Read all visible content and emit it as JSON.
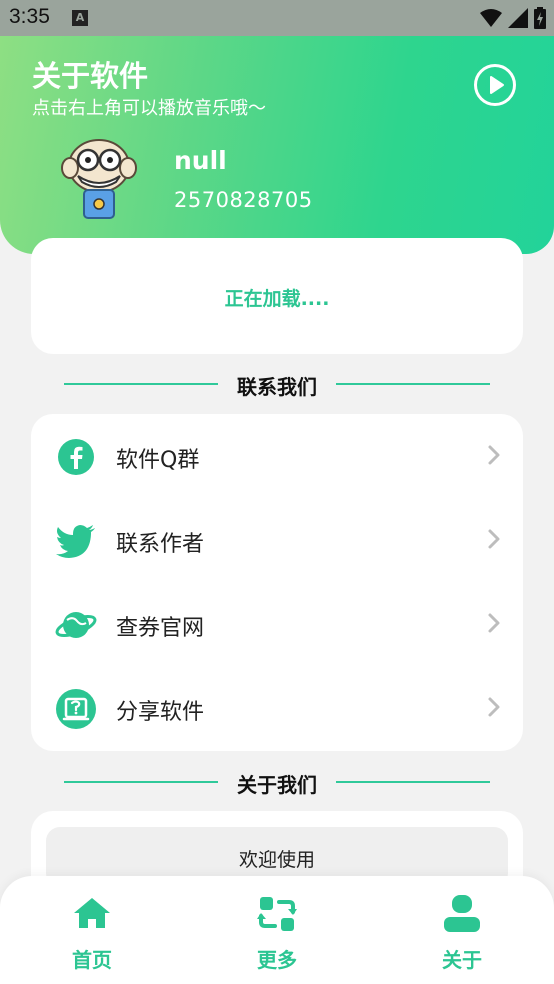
{
  "status_bar": {
    "time": "3:35",
    "notification_letter": "A",
    "icons": [
      "wifi-icon",
      "signal-icon",
      "battery-icon"
    ]
  },
  "header": {
    "title": "关于软件",
    "subtitle": "点击右上角可以播放音乐哦～",
    "play_icon": "play-circle-icon",
    "user": {
      "name": "null",
      "id": "2570828705"
    }
  },
  "loading": {
    "text": "正在加载...."
  },
  "contact_section": {
    "title": "联系我们",
    "items": [
      {
        "label": "软件Q群",
        "icon": "facebook-icon"
      },
      {
        "label": "联系作者",
        "icon": "twitter-icon"
      },
      {
        "label": "查券官网",
        "icon": "planet-icon"
      },
      {
        "label": "分享软件",
        "icon": "share-box-icon"
      }
    ]
  },
  "about_section": {
    "title": "关于我们",
    "welcome": "欢迎使用"
  },
  "bottom_nav": {
    "items": [
      {
        "label": "首页",
        "icon": "home-icon"
      },
      {
        "label": "更多",
        "icon": "refresh-icon"
      },
      {
        "label": "关于",
        "icon": "user-icon"
      }
    ]
  },
  "colors": {
    "accent": "#2cc592",
    "header_gradient_start": "#8edf83",
    "header_gradient_end": "#22d39a"
  }
}
